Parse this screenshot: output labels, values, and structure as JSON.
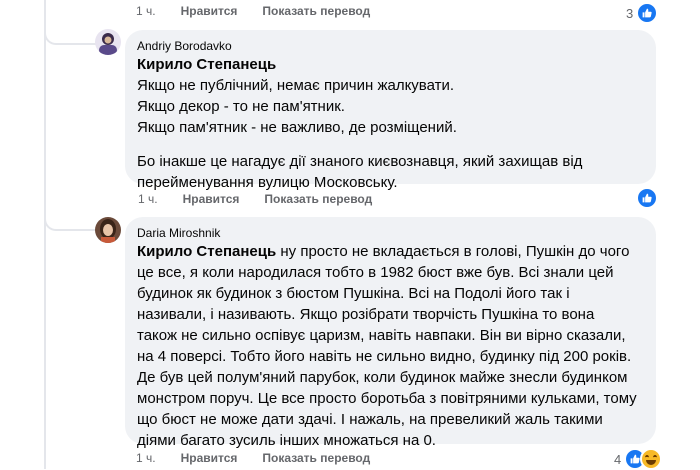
{
  "colors": {
    "like_blue": "#1877f2",
    "bubble_bg": "#f0f2f5",
    "meta_gray": "#65676b"
  },
  "top_row": {
    "time": "1 ч.",
    "like": "Нравится",
    "translate": "Показать перевод",
    "reaction_count": "3",
    "reaction_icons": [
      "like-icon"
    ]
  },
  "comments": [
    {
      "author": "Andriy Borodavko",
      "tag": "Кирило Степанець",
      "paragraphs": [
        "Якщо не публічний, немає причин жалкувати.",
        "Якщо декор - то не пам'ятник.",
        "Якщо пам'ятник - не важливо, де розміщений."
      ],
      "extra": "Бо інакше це нагадує дії знаного києвознавця, який захищав від перейменування вулицю Московську.",
      "time": "1 ч.",
      "like": "Нравится",
      "translate": "Показать перевод",
      "reaction_count": "",
      "reaction_icons": [
        "like-icon"
      ]
    },
    {
      "author": "Daria Miroshnik",
      "tag": "Кирило Степанець",
      "body": " ну просто не вкладається в голові, Пушкін до чого це все, я коли народилася тобто в 1982 бюст вже був. Всі знали цей будинок як будинок з бюстом Пушкіна. Всі на Подолі його так і називали, і називають. Якщо розібрати творчість Пушкіна то вона також не сильно оспівує царизм, навіть навпаки. Він ви вірно сказали, на 4 поверсі. Тобто його навіть не сильно видно, будинку під 200 років. Де був цей полум'яний парубок, коли будинок майже знесли будинком монстром поруч. Це все просто боротьба з повітряними кульками, тому що бюст не може дати здачі. І нажаль, на превеликий жаль такими діями багато зусиль інших множаться на 0.",
      "time": "1 ч.",
      "like": "Нравится",
      "translate": "Показать перевод",
      "reaction_count": "4",
      "reaction_icons": [
        "like-icon",
        "haha-icon"
      ]
    }
  ]
}
